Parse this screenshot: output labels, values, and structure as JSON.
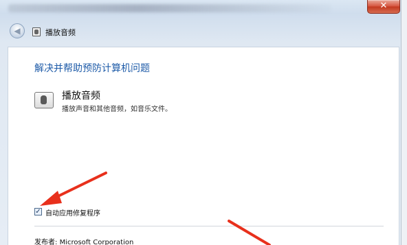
{
  "window": {
    "close_glyph": "✕"
  },
  "navbar": {
    "back_glyph": "◀",
    "title": "播放音频"
  },
  "main": {
    "headline": "解决并帮助预防计算机问题",
    "item": {
      "title": "播放音频",
      "description": "播放声音和其他音频，如音乐文件。",
      "icon": "audio-speaker-icon"
    },
    "auto_repair": {
      "label": "自动应用修复程序",
      "checked": true,
      "check_glyph": "✓"
    },
    "publisher": {
      "label": "发布者:",
      "value": "Microsoft Corporation"
    }
  },
  "colors": {
    "headline": "#1e5ba8",
    "annotation_arrow": "#e8301c",
    "close_button": "#d5523c"
  }
}
